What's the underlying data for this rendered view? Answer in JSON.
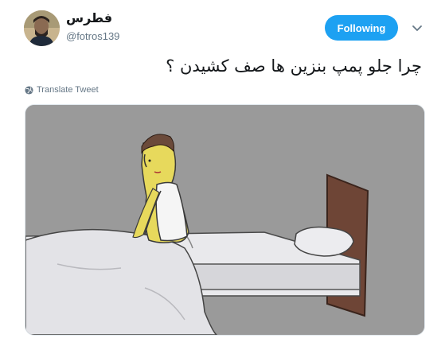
{
  "tweet": {
    "author_name": "فطرس",
    "author_handle": "@fotros139",
    "text": "چرا جلو پمپ بنزین ها صف کشیدن ؟",
    "translate_label": "Translate Tweet",
    "follow_label": "Following"
  },
  "icons": {
    "caret": "chevron-down-icon",
    "translate": "globe-icon"
  },
  "colors": {
    "accent": "#1da1f2",
    "secondary_text": "#657786",
    "primary_text": "#14171a"
  }
}
